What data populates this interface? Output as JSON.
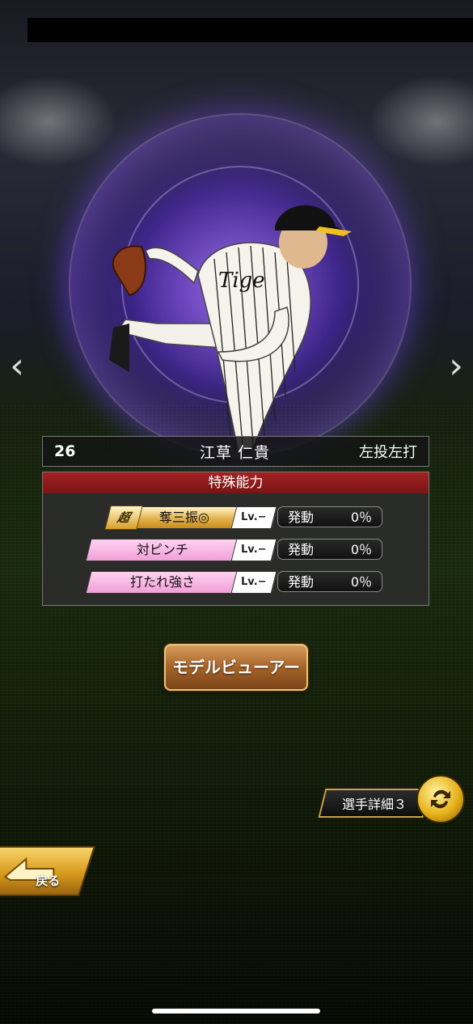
{
  "player": {
    "number": "26",
    "name": "江草 仁貴",
    "handedness": "左投左打"
  },
  "abilities": {
    "header": "特殊能力",
    "super_tag": "超",
    "items": [
      {
        "name": "奪三振◎",
        "level": "Lv.−",
        "activation_label": "発動",
        "activation_value": "0％",
        "style": "gold"
      },
      {
        "name": "対ピンチ",
        "level": "Lv.−",
        "activation_label": "発動",
        "activation_value": "0％",
        "style": "pink"
      },
      {
        "name": "打たれ強さ",
        "level": "Lv.−",
        "activation_label": "発動",
        "activation_value": "0％",
        "style": "pink"
      }
    ]
  },
  "buttons": {
    "model_viewer": "モデルビューアー",
    "player_detail": "選手詳細３",
    "back": "戻る"
  },
  "icons": {
    "prev": "chevron-left-icon",
    "next": "chevron-right-icon",
    "swap": "swap-arrows-icon",
    "back": "back-arrow-icon"
  },
  "colors": {
    "header_red": "#a32222",
    "gold": "#e3b24d",
    "pink": "#f0a0d8",
    "aura_purple": "#9a5aff"
  }
}
